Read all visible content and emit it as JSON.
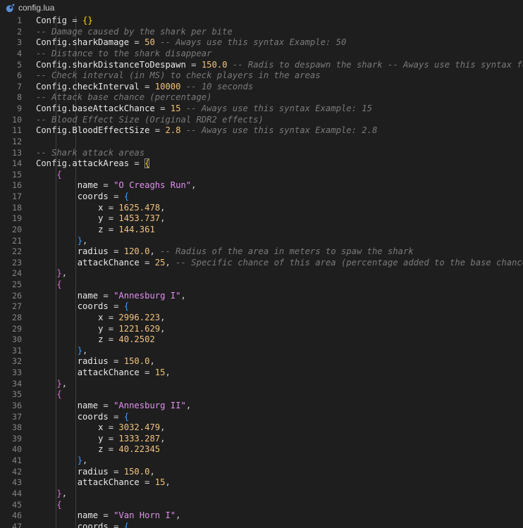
{
  "tab": {
    "filename": "config.lua",
    "icon": "lua-file-icon"
  },
  "colors": {
    "background": "#1e1e1e",
    "line_number": "#858585",
    "number": "#f2c37d",
    "string": "#e28ff0",
    "comment": "#7a7a7a",
    "bracket_level1": "#ffd700",
    "bracket_level2": "#da70d6",
    "bracket_level3": "#3a9bff"
  },
  "lines": [
    {
      "n": "1",
      "indent": 0,
      "tokens": [
        [
          "id",
          "Config"
        ],
        [
          "op",
          " = "
        ],
        [
          "b1",
          "{}"
        ]
      ]
    },
    {
      "n": "2",
      "indent": 0,
      "tokens": [
        [
          "cm",
          "-- Damage caused by the shark per bite"
        ]
      ]
    },
    {
      "n": "3",
      "indent": 0,
      "tokens": [
        [
          "id",
          "Config"
        ],
        [
          "op",
          "."
        ],
        [
          "prop",
          "sharkDamage"
        ],
        [
          "op",
          " = "
        ],
        [
          "num",
          "50"
        ],
        [
          "cm",
          " -- Aways use this syntax Example: 50"
        ]
      ]
    },
    {
      "n": "4",
      "indent": 0,
      "tokens": [
        [
          "cm",
          "-- Distance to the shark disappear"
        ]
      ]
    },
    {
      "n": "5",
      "indent": 0,
      "tokens": [
        [
          "id",
          "Config"
        ],
        [
          "op",
          "."
        ],
        [
          "prop",
          "sharkDistanceToDespawn"
        ],
        [
          "op",
          " = "
        ],
        [
          "num",
          "150.0"
        ],
        [
          "cm",
          " -- Radis to despawn the shark -- Aways use this syntax for the d"
        ]
      ]
    },
    {
      "n": "6",
      "indent": 0,
      "tokens": [
        [
          "cm",
          "-- Check interval (in MS) to check players in the areas"
        ]
      ]
    },
    {
      "n": "7",
      "indent": 0,
      "tokens": [
        [
          "id",
          "Config"
        ],
        [
          "op",
          "."
        ],
        [
          "prop",
          "checkInterval"
        ],
        [
          "op",
          " = "
        ],
        [
          "num",
          "10000"
        ],
        [
          "cm",
          " -- 10 seconds"
        ]
      ]
    },
    {
      "n": "8",
      "indent": 0,
      "tokens": [
        [
          "cm",
          "-- Attack base chance (percentage)"
        ]
      ]
    },
    {
      "n": "9",
      "indent": 0,
      "tokens": [
        [
          "id",
          "Config"
        ],
        [
          "op",
          "."
        ],
        [
          "prop",
          "baseAttackChance"
        ],
        [
          "op",
          " = "
        ],
        [
          "num",
          "15"
        ],
        [
          "cm",
          " -- Aways use this syntax Example: 15"
        ]
      ]
    },
    {
      "n": "10",
      "indent": 0,
      "tokens": [
        [
          "cm",
          "-- Blood Effect Size (Original RDR2 effects)"
        ]
      ]
    },
    {
      "n": "11",
      "indent": 0,
      "tokens": [
        [
          "id",
          "Config"
        ],
        [
          "op",
          "."
        ],
        [
          "prop",
          "BloodEffectSize"
        ],
        [
          "op",
          " = "
        ],
        [
          "num",
          "2.8"
        ],
        [
          "cm",
          " -- Aways use this syntax Example: 2.8"
        ]
      ]
    },
    {
      "n": "12",
      "indent": 0,
      "tokens": []
    },
    {
      "n": "13",
      "indent": 0,
      "tokens": [
        [
          "cm",
          "-- Shark attack areas"
        ]
      ]
    },
    {
      "n": "14",
      "indent": 0,
      "tokens": [
        [
          "id",
          "Config"
        ],
        [
          "op",
          "."
        ],
        [
          "prop",
          "attackAreas"
        ],
        [
          "op",
          " = "
        ],
        [
          "b1sel",
          "{"
        ]
      ]
    },
    {
      "n": "15",
      "indent": 1,
      "tokens": [
        [
          "b2",
          "{"
        ]
      ]
    },
    {
      "n": "16",
      "indent": 2,
      "tokens": [
        [
          "prop",
          "name"
        ],
        [
          "op",
          " = "
        ],
        [
          "str",
          "\"O Creaghs Run\""
        ],
        [
          "op",
          ","
        ]
      ]
    },
    {
      "n": "17",
      "indent": 2,
      "tokens": [
        [
          "prop",
          "coords"
        ],
        [
          "op",
          " = "
        ],
        [
          "b3",
          "{"
        ]
      ]
    },
    {
      "n": "18",
      "indent": 3,
      "tokens": [
        [
          "prop",
          "x"
        ],
        [
          "op",
          " = "
        ],
        [
          "num",
          "1625.478"
        ],
        [
          "op",
          ","
        ]
      ]
    },
    {
      "n": "19",
      "indent": 3,
      "tokens": [
        [
          "prop",
          "y"
        ],
        [
          "op",
          " = "
        ],
        [
          "num",
          "1453.737"
        ],
        [
          "op",
          ","
        ]
      ]
    },
    {
      "n": "20",
      "indent": 3,
      "tokens": [
        [
          "prop",
          "z"
        ],
        [
          "op",
          " = "
        ],
        [
          "num",
          "144.361"
        ]
      ]
    },
    {
      "n": "21",
      "indent": 2,
      "tokens": [
        [
          "b3",
          "}"
        ],
        [
          "op",
          ","
        ]
      ]
    },
    {
      "n": "22",
      "indent": 2,
      "tokens": [
        [
          "prop",
          "radius"
        ],
        [
          "op",
          " = "
        ],
        [
          "num",
          "120.0"
        ],
        [
          "op",
          ", "
        ],
        [
          "cm",
          "-- Radius of the area in meters to spaw the shark"
        ]
      ]
    },
    {
      "n": "23",
      "indent": 2,
      "tokens": [
        [
          "prop",
          "attackChance"
        ],
        [
          "op",
          " = "
        ],
        [
          "num",
          "25"
        ],
        [
          "op",
          ", "
        ],
        [
          "cm",
          "-- Specific chance of this area (percentage added to the base chance)"
        ]
      ]
    },
    {
      "n": "24",
      "indent": 1,
      "tokens": [
        [
          "b2",
          "}"
        ],
        [
          "op",
          ","
        ]
      ]
    },
    {
      "n": "25",
      "indent": 1,
      "tokens": [
        [
          "b2",
          "{"
        ]
      ]
    },
    {
      "n": "26",
      "indent": 2,
      "tokens": [
        [
          "prop",
          "name"
        ],
        [
          "op",
          " = "
        ],
        [
          "str",
          "\"Annesburg I\""
        ],
        [
          "op",
          ","
        ]
      ]
    },
    {
      "n": "27",
      "indent": 2,
      "tokens": [
        [
          "prop",
          "coords"
        ],
        [
          "op",
          " = "
        ],
        [
          "b3",
          "{"
        ]
      ]
    },
    {
      "n": "28",
      "indent": 3,
      "tokens": [
        [
          "prop",
          "x"
        ],
        [
          "op",
          " = "
        ],
        [
          "num",
          "2996.223"
        ],
        [
          "op",
          ","
        ]
      ]
    },
    {
      "n": "29",
      "indent": 3,
      "tokens": [
        [
          "prop",
          "y"
        ],
        [
          "op",
          " = "
        ],
        [
          "num",
          "1221.629"
        ],
        [
          "op",
          ","
        ]
      ]
    },
    {
      "n": "30",
      "indent": 3,
      "tokens": [
        [
          "prop",
          "z"
        ],
        [
          "op",
          " = "
        ],
        [
          "num",
          "40.2502"
        ]
      ]
    },
    {
      "n": "31",
      "indent": 2,
      "tokens": [
        [
          "b3",
          "}"
        ],
        [
          "op",
          ","
        ]
      ]
    },
    {
      "n": "32",
      "indent": 2,
      "tokens": [
        [
          "prop",
          "radius"
        ],
        [
          "op",
          " = "
        ],
        [
          "num",
          "150.0"
        ],
        [
          "op",
          ","
        ]
      ]
    },
    {
      "n": "33",
      "indent": 2,
      "tokens": [
        [
          "prop",
          "attackChance"
        ],
        [
          "op",
          " = "
        ],
        [
          "num",
          "15"
        ],
        [
          "op",
          ","
        ]
      ]
    },
    {
      "n": "34",
      "indent": 1,
      "tokens": [
        [
          "b2",
          "}"
        ],
        [
          "op",
          ","
        ]
      ]
    },
    {
      "n": "35",
      "indent": 1,
      "tokens": [
        [
          "b2",
          "{"
        ]
      ]
    },
    {
      "n": "36",
      "indent": 2,
      "tokens": [
        [
          "prop",
          "name"
        ],
        [
          "op",
          " = "
        ],
        [
          "str",
          "\"Annesburg II\""
        ],
        [
          "op",
          ","
        ]
      ]
    },
    {
      "n": "37",
      "indent": 2,
      "tokens": [
        [
          "prop",
          "coords"
        ],
        [
          "op",
          " = "
        ],
        [
          "b3",
          "{"
        ]
      ]
    },
    {
      "n": "38",
      "indent": 3,
      "tokens": [
        [
          "prop",
          "x"
        ],
        [
          "op",
          " = "
        ],
        [
          "num",
          "3032.479"
        ],
        [
          "op",
          ","
        ]
      ]
    },
    {
      "n": "39",
      "indent": 3,
      "tokens": [
        [
          "prop",
          "y"
        ],
        [
          "op",
          " = "
        ],
        [
          "num",
          "1333.287"
        ],
        [
          "op",
          ","
        ]
      ]
    },
    {
      "n": "40",
      "indent": 3,
      "tokens": [
        [
          "prop",
          "z"
        ],
        [
          "op",
          " = "
        ],
        [
          "num",
          "40.22345"
        ]
      ]
    },
    {
      "n": "41",
      "indent": 2,
      "tokens": [
        [
          "b3",
          "}"
        ],
        [
          "op",
          ","
        ]
      ]
    },
    {
      "n": "42",
      "indent": 2,
      "tokens": [
        [
          "prop",
          "radius"
        ],
        [
          "op",
          " = "
        ],
        [
          "num",
          "150.0"
        ],
        [
          "op",
          ","
        ]
      ]
    },
    {
      "n": "43",
      "indent": 2,
      "tokens": [
        [
          "prop",
          "attackChance"
        ],
        [
          "op",
          " = "
        ],
        [
          "num",
          "15"
        ],
        [
          "op",
          ","
        ]
      ]
    },
    {
      "n": "44",
      "indent": 1,
      "tokens": [
        [
          "b2",
          "}"
        ],
        [
          "op",
          ","
        ]
      ]
    },
    {
      "n": "45",
      "indent": 1,
      "tokens": [
        [
          "b2",
          "{"
        ]
      ]
    },
    {
      "n": "46",
      "indent": 2,
      "tokens": [
        [
          "prop",
          "name"
        ],
        [
          "op",
          " = "
        ],
        [
          "str",
          "\"Van Horn I\""
        ],
        [
          "op",
          ","
        ]
      ]
    },
    {
      "n": "47",
      "indent": 2,
      "tokens": [
        [
          "prop",
          "coords"
        ],
        [
          "op",
          " = "
        ],
        [
          "b3",
          "{"
        ]
      ]
    }
  ]
}
